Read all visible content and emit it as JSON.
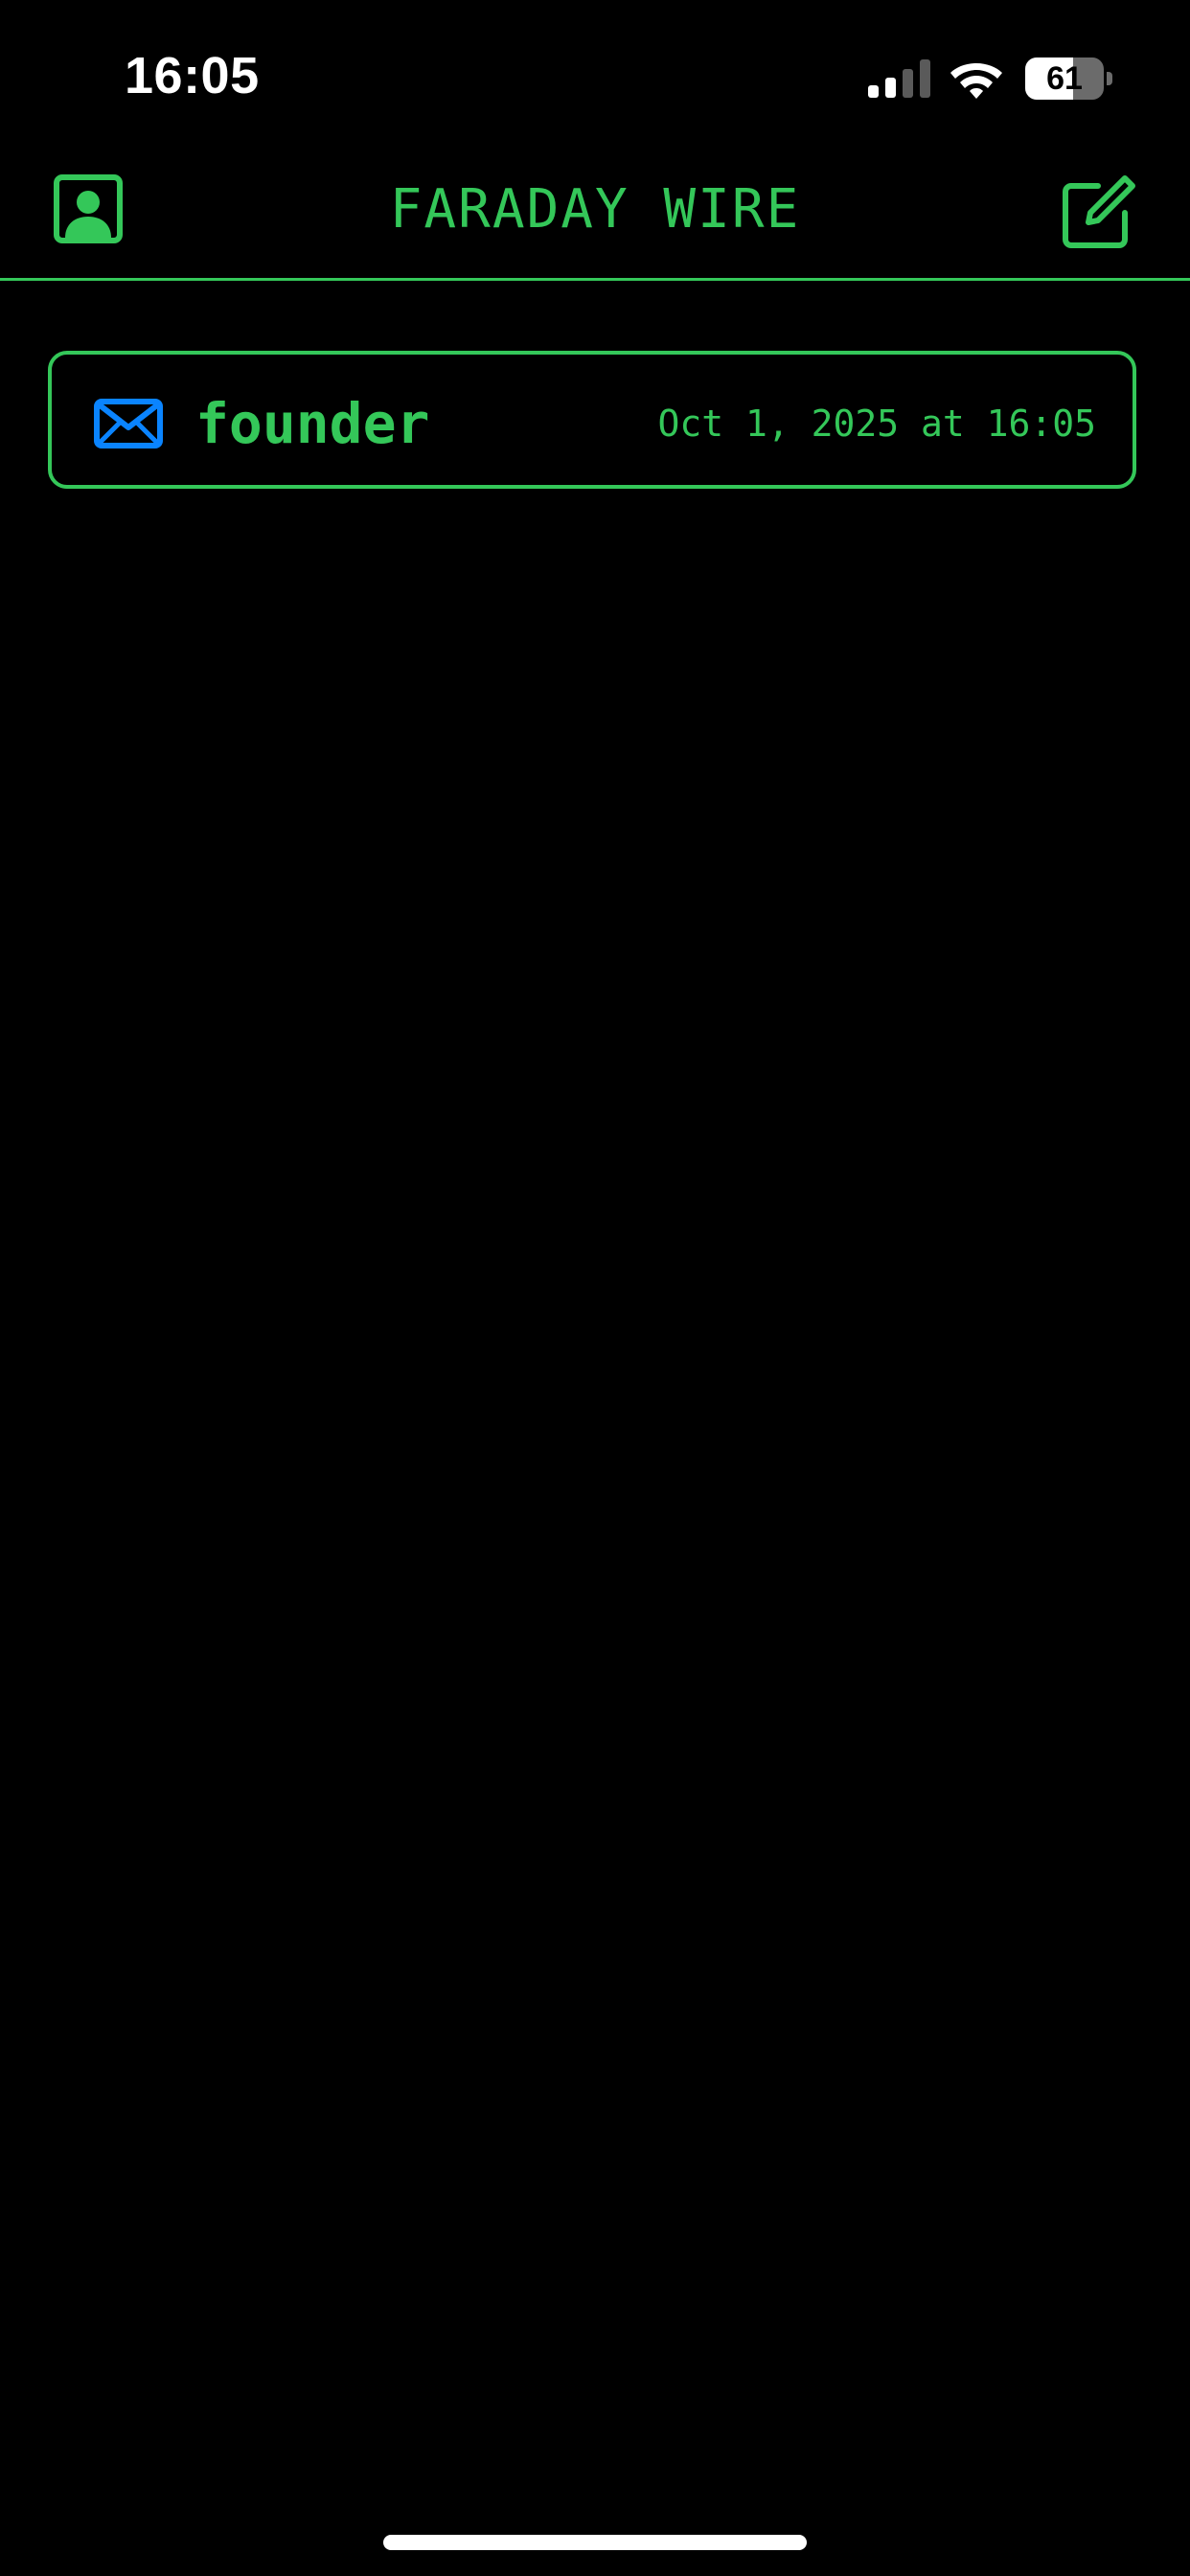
{
  "status_bar": {
    "time": "16:05",
    "battery_level": "61",
    "battery_fraction": 0.61,
    "icons": [
      "cellular-signal-icon",
      "wifi-icon",
      "battery-icon"
    ]
  },
  "header": {
    "title": "FARADAY WIRE",
    "left_icon": "profile-icon",
    "right_icon": "compose-icon"
  },
  "messages": [
    {
      "icon": "envelope-icon",
      "sender": "founder",
      "timestamp": "Oct 1, 2025 at 16:05"
    }
  ],
  "colors": {
    "background": "#000000",
    "accent": "#34C759",
    "unread_icon": "#0A84FF",
    "status_text": "#FFFFFF"
  }
}
